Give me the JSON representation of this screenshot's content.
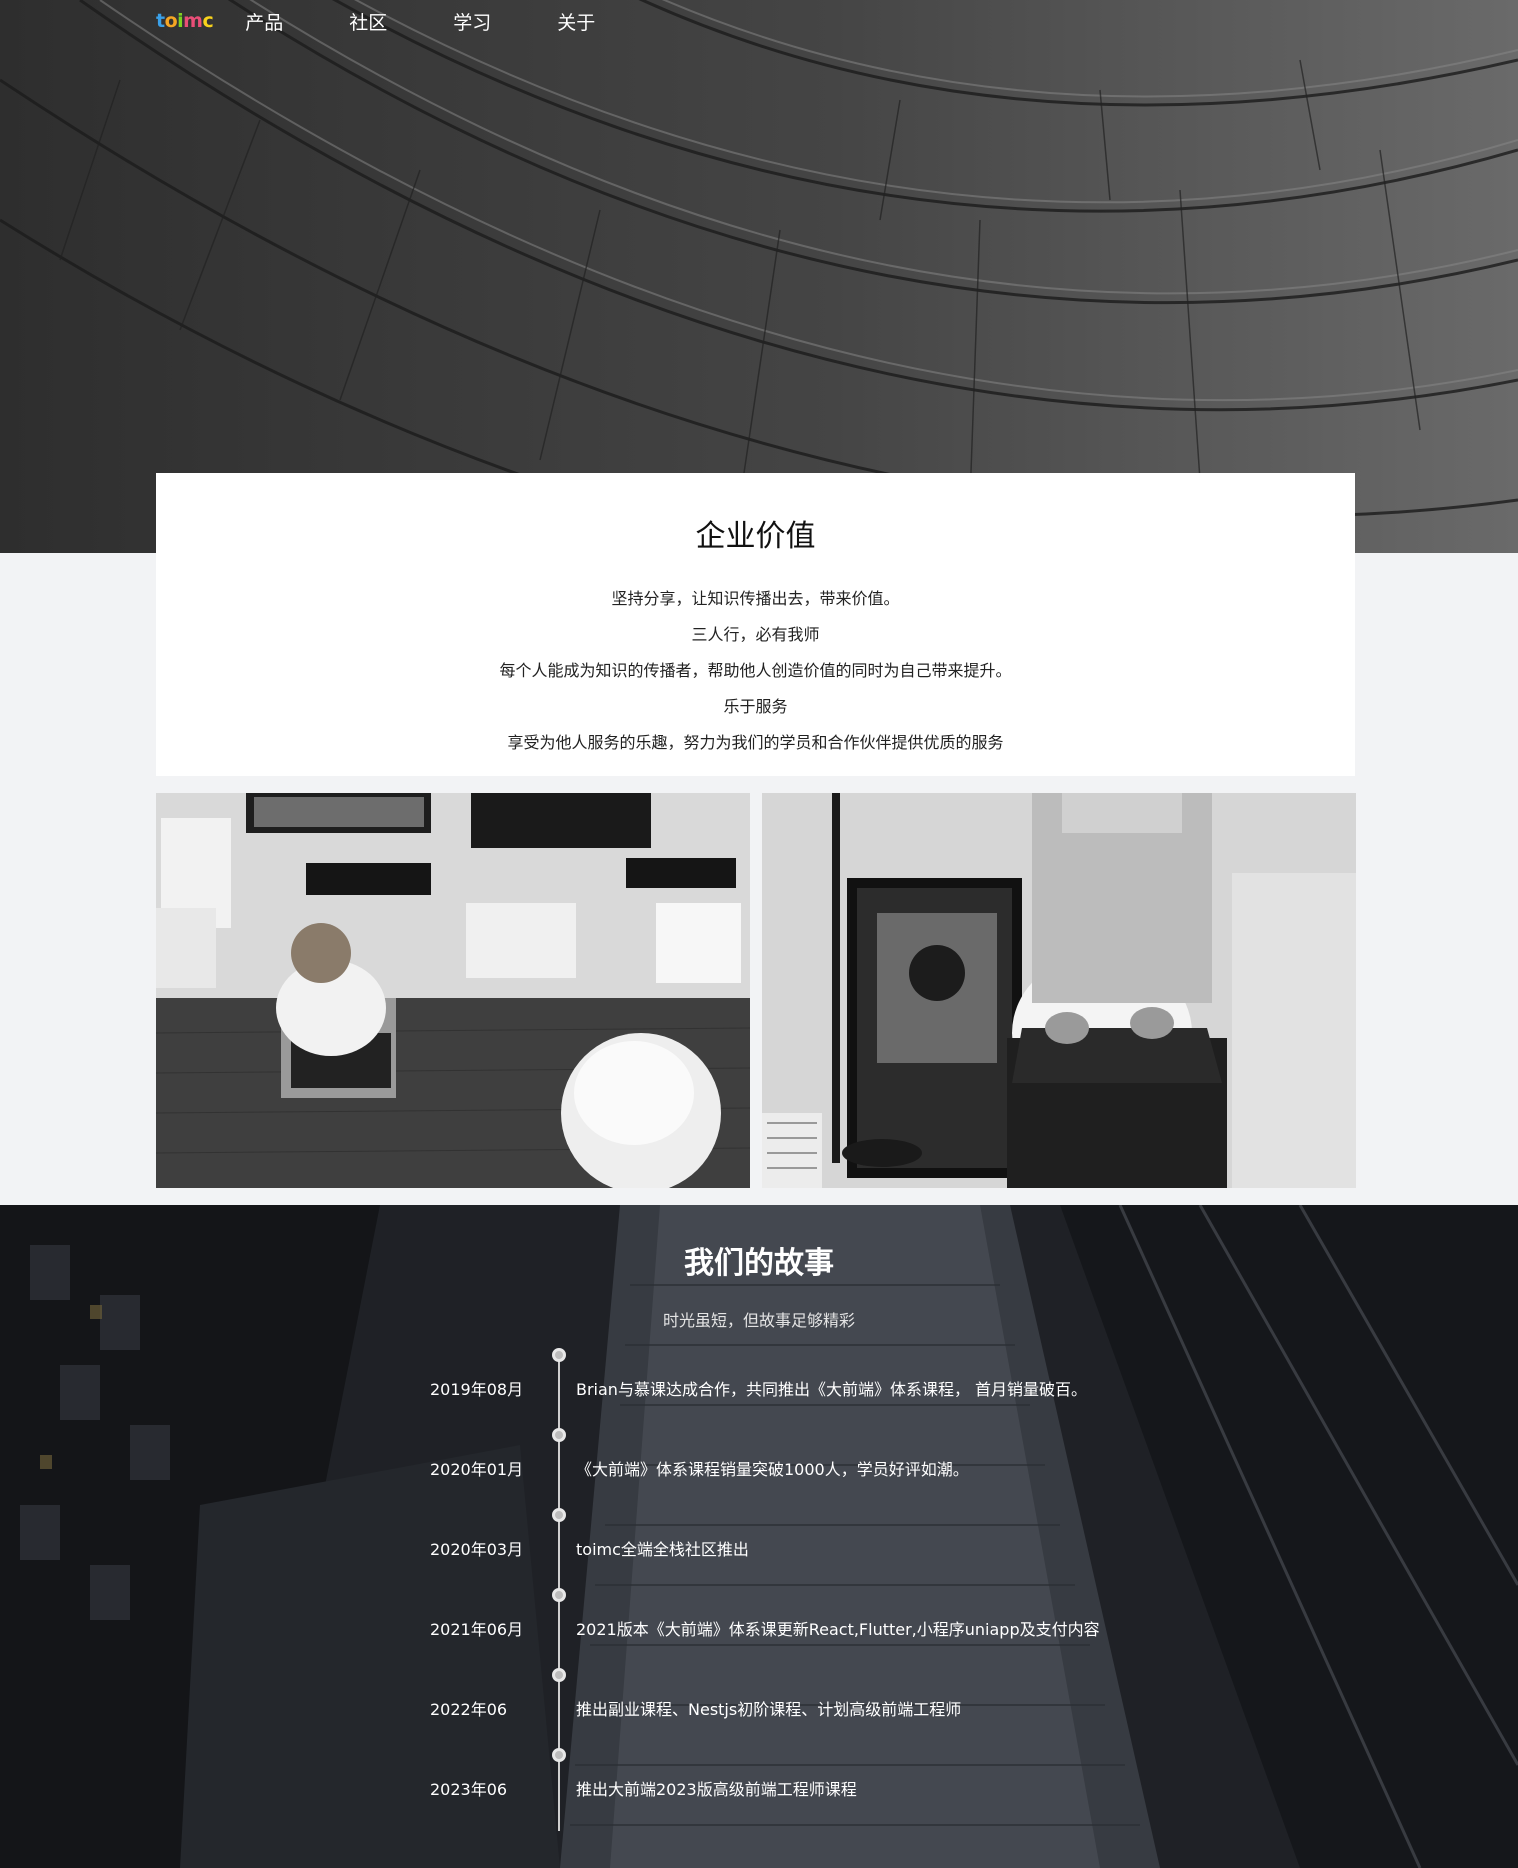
{
  "brand": {
    "logo_letters": [
      "t",
      "o",
      "i",
      "m",
      "c"
    ]
  },
  "nav": {
    "items": [
      {
        "label": "产品"
      },
      {
        "label": "社区"
      },
      {
        "label": "学习"
      },
      {
        "label": "关于"
      }
    ]
  },
  "values": {
    "title": "企业价值",
    "lines": [
      "坚持分享，让知识传播出去，带来价值。",
      "三人行，必有我师",
      "每个人能成为知识的传播者，帮助他人创造价值的同时为自己带来提升。",
      "乐于服务",
      "享受为他人服务的乐趣，努力为我们的学员和合作伙伴提供优质的服务"
    ]
  },
  "story": {
    "title": "我们的故事",
    "subtitle": "时光虽短，但故事足够精彩",
    "events": [
      {
        "date": "2019年08月",
        "text": "Brian与慕课达成合作，共同推出《大前端》体系课程， 首月销量破百。"
      },
      {
        "date": "2020年01月",
        "text": "《大前端》体系课程销量突破1000人，学员好评如潮。"
      },
      {
        "date": "2020年03月",
        "text": "toimc全端全栈社区推出"
      },
      {
        "date": "2021年06月",
        "text": "2021版本《大前端》体系课更新React,Flutter,小程序uniapp及支付内容"
      },
      {
        "date": "2022年06",
        "text": "推出副业课程、Nestjs初阶课程、计划高级前端工程师"
      },
      {
        "date": "2023年06",
        "text": "推出大前端2023版高级前端工程师课程"
      }
    ]
  }
}
